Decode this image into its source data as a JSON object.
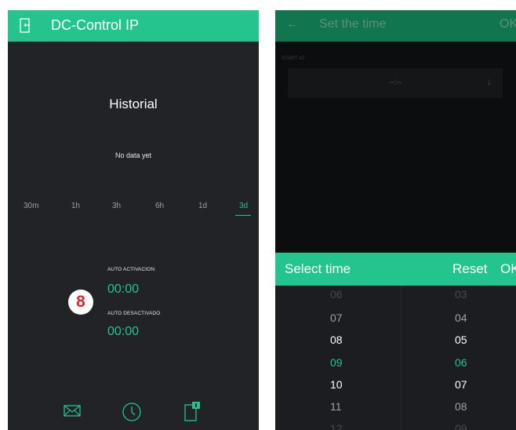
{
  "left_screen": {
    "app_title": "DC-Control IP",
    "historial_title": "Historial",
    "no_data": "No data yet",
    "ranges": [
      "30m",
      "1h",
      "3h",
      "6h",
      "1d",
      "3d"
    ],
    "active_range": "3d",
    "auto_activacion_label": "AUTO  ACTIVACION",
    "auto_activacion_time": "00:00",
    "auto_desactivado_label": "AUTO DESACTIVADO",
    "auto_desactivado_time": "00:00",
    "badge_number": "8",
    "tabs": [
      "mail-icon",
      "clock-icon",
      "device-notification-icon"
    ]
  },
  "right_screen": {
    "back_arrow": "←",
    "title": "Set the time",
    "ok_label": "OK",
    "start_at_label": "START AT",
    "start_at_value": "--:--",
    "dropdown_arrow": "↓",
    "select_time_label": "Select time",
    "reset_label": "Reset",
    "select_ok_label": "OK",
    "hours": [
      "06",
      "07",
      "08",
      "09",
      "10",
      "11",
      "12"
    ],
    "minutes": [
      "03",
      "04",
      "05",
      "06",
      "07",
      "08",
      "09"
    ],
    "selected_hour": "09",
    "selected_minute": "06"
  },
  "colors": {
    "accent": "#23c48e",
    "badge_red": "#e0252d",
    "dark_bg": "#212327"
  }
}
